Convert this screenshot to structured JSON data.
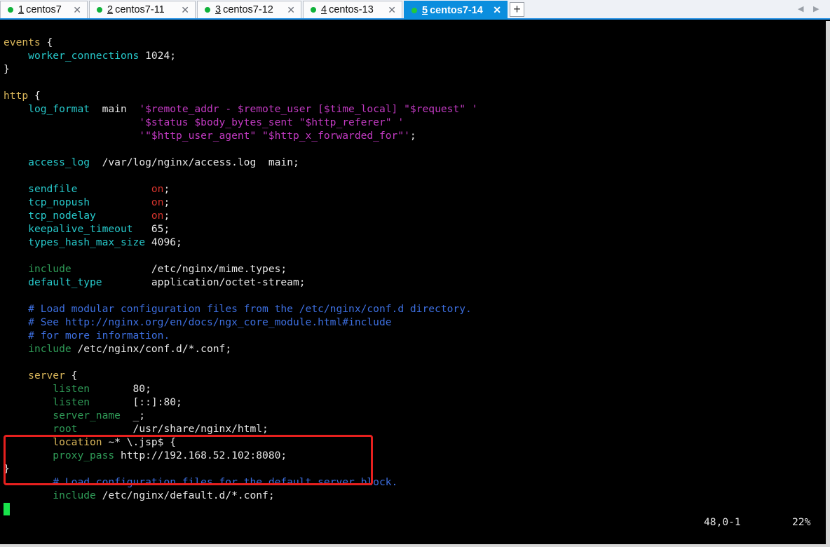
{
  "tabs": [
    {
      "num": "1",
      "label": "centos7"
    },
    {
      "num": "2",
      "label": "centos7-11"
    },
    {
      "num": "3",
      "label": "centos7-12"
    },
    {
      "num": "4",
      "label": "centos-13"
    },
    {
      "num": "5",
      "label": "centos7-14"
    }
  ],
  "tab_close_glyph": "✕",
  "add_tab_glyph": "+",
  "nav": {
    "left": "◀",
    "right": "▶"
  },
  "terminal": {
    "lines": {
      "l1": [
        "events",
        " {"
      ],
      "l2": [
        "    ",
        "worker_connections",
        " 1024;"
      ],
      "l3": [
        "}"
      ],
      "l4": [
        "http",
        " {"
      ],
      "l5": [
        "    ",
        "log_format",
        "  main  ",
        "'$remote_addr - $remote_user [$time_local] \"$request\" '"
      ],
      "l6": [
        "                      ",
        "'$status $body_bytes_sent \"$http_referer\" '"
      ],
      "l7": [
        "                      ",
        "'\"$http_user_agent\" \"$http_x_forwarded_for\"'",
        ";"
      ],
      "l8": [
        "    ",
        "access_log",
        "  /var/log/nginx/access.log  main;"
      ],
      "l9": [
        "    ",
        "sendfile",
        "            ",
        "on",
        ";"
      ],
      "l10": [
        "    ",
        "tcp_nopush",
        "          ",
        "on",
        ";"
      ],
      "l11": [
        "    ",
        "tcp_nodelay",
        "         ",
        "on",
        ";"
      ],
      "l12": [
        "    ",
        "keepalive_timeout",
        "   65;"
      ],
      "l13": [
        "    ",
        "types_hash_max_size",
        " 4096;"
      ],
      "l14": [
        "    ",
        "include",
        "             /etc/nginx/mime.types;"
      ],
      "l15": [
        "    ",
        "default_type",
        "        application/octet-stream;"
      ],
      "l16": [
        "    ",
        "# Load modular configuration files from the /etc/nginx/conf.d directory."
      ],
      "l17": [
        "    ",
        "# See http://nginx.org/en/docs/ngx_core_module.html#include"
      ],
      "l18": [
        "    ",
        "# for more information."
      ],
      "l19": [
        "    ",
        "include",
        " /etc/nginx/conf.d/*.conf;"
      ],
      "l20": [
        "    ",
        "server",
        " {"
      ],
      "l21": [
        "        ",
        "listen",
        "       80;"
      ],
      "l22": [
        "        ",
        "listen",
        "       [::]:80;"
      ],
      "l23": [
        "        ",
        "server_name",
        "  _;"
      ],
      "l24": [
        "        ",
        "root",
        "         /usr/share/nginx/html;"
      ],
      "l25": [
        "        ",
        "location",
        " ~* \\.jsp$ {"
      ],
      "l26": [
        "        ",
        "proxy_pass",
        " http://192.168.52.102:8080;"
      ],
      "l27": [
        "}"
      ],
      "l28": [
        "        ",
        "# Load configuration files for the default server block."
      ],
      "l29": [
        "        ",
        "include",
        " /etc/nginx/default.d/*.conf;"
      ]
    },
    "status_position": "48,0-1",
    "status_percent": "22%"
  },
  "colors": {
    "tab_active": "#0b8ede",
    "status_dot": "#10b23a",
    "keyword": "#d9b65a",
    "directive": "#27c9cb",
    "string": "#c23ac2",
    "comment": "#3d6fe0",
    "highlight_box": "#e6201e",
    "cursor": "#18e34b"
  }
}
